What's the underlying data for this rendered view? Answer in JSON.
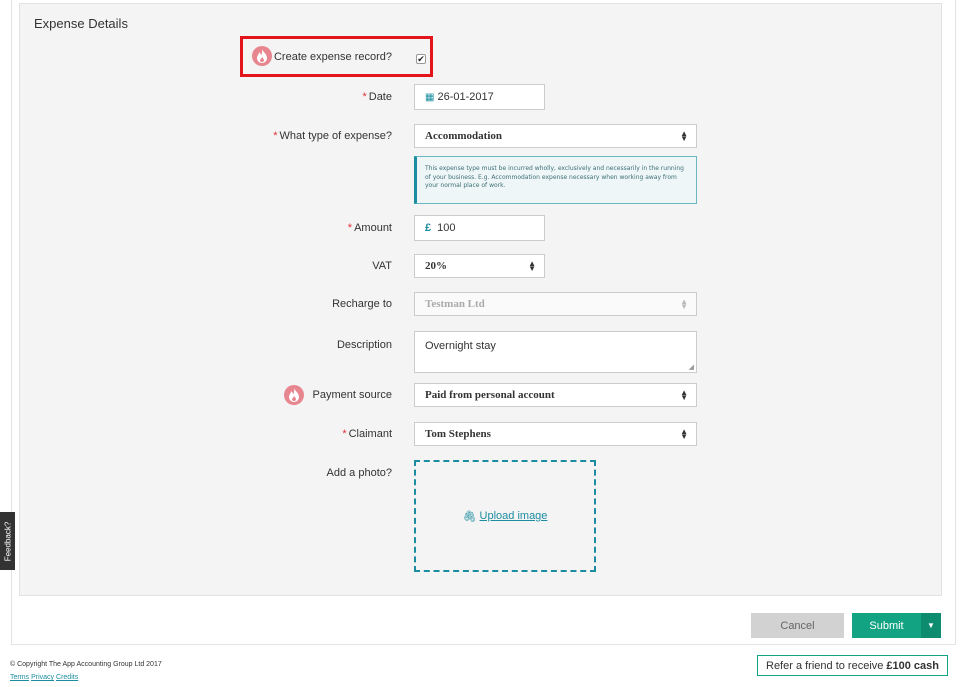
{
  "panel": {
    "title": "Expense Details"
  },
  "create_record": {
    "label": "Create expense record?",
    "checked": true,
    "check_glyph": "✔"
  },
  "date": {
    "label": "Date",
    "value": "26-01-2017",
    "icon": "calendar-icon"
  },
  "expense_type": {
    "label": "What type of expense?",
    "value": "Accommodation",
    "info": "This expense type must be incurred wholly, exclusively and necessarily in the running of your business. E.g. Accommodation expense necessary when working away from your normal place of work."
  },
  "amount": {
    "label": "Amount",
    "currency": "£",
    "value": "100"
  },
  "vat": {
    "label": "VAT",
    "value": "20%"
  },
  "recharge": {
    "label": "Recharge to",
    "value": "Testman Ltd"
  },
  "description": {
    "label": "Description",
    "value": "Overnight stay"
  },
  "payment_source": {
    "label": "Payment source",
    "value": "Paid from personal account"
  },
  "claimant": {
    "label": "Claimant",
    "value": "Tom Stephens"
  },
  "photo": {
    "label": "Add a photo?",
    "upload_label": "Upload image"
  },
  "required_marker": "*",
  "actions": {
    "cancel": "Cancel",
    "submit": "Submit"
  },
  "feedback": "Feedback?",
  "footer": {
    "copyright": "© Copyright The App Accounting Group Ltd 2017",
    "links": [
      "Terms",
      "Privacy",
      "Credits"
    ]
  },
  "refer": {
    "text": "Refer a friend to receive",
    "amount": "£100 cash"
  },
  "colors": {
    "accent": "#1c8da0",
    "submit": "#12a383",
    "required": "#e0303a",
    "highlight": "#e3151b",
    "flame": "#e8868f"
  }
}
